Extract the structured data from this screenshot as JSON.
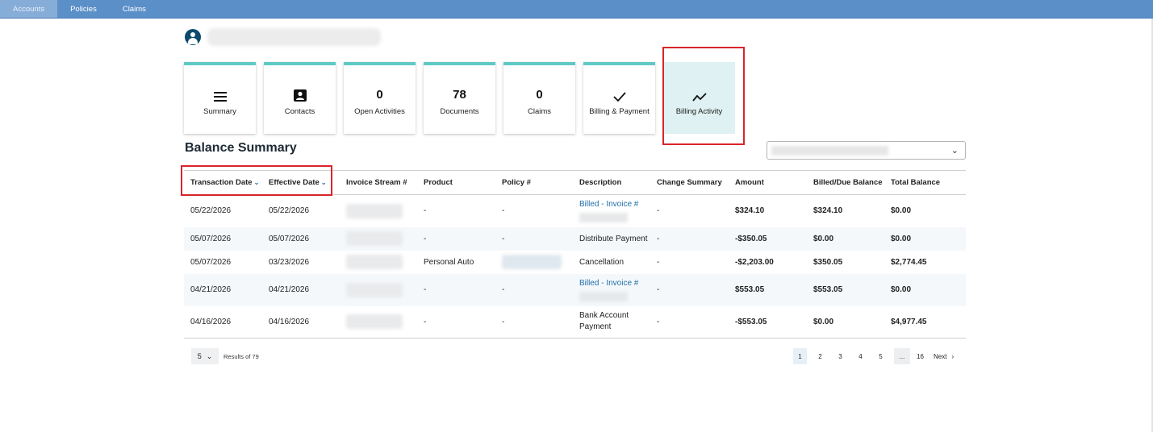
{
  "nav": {
    "tabs": [
      {
        "label": "Accounts"
      },
      {
        "label": "Policies"
      },
      {
        "label": "Claims"
      }
    ]
  },
  "tiles": [
    {
      "icon": "menu-icon",
      "value": "",
      "label": "Summary"
    },
    {
      "icon": "contact-card-icon",
      "value": "",
      "label": "Contacts"
    },
    {
      "icon": "",
      "value": "0",
      "label": "Open Activities"
    },
    {
      "icon": "",
      "value": "78",
      "label": "Documents"
    },
    {
      "icon": "",
      "value": "0",
      "label": "Claims"
    },
    {
      "icon": "checkmark-icon",
      "value": "",
      "label": "Billing & Payment"
    },
    {
      "icon": "trend-line-icon",
      "value": "",
      "label": "Billing Activity"
    }
  ],
  "section": {
    "title": "Balance Summary"
  },
  "table": {
    "headers": [
      "Transaction Date",
      "Effective Date",
      "Invoice Stream #",
      "Product",
      "Policy #",
      "Description",
      "Change Summary",
      "Amount",
      "Billed/Due Balance",
      "Total Balance"
    ],
    "rows": [
      {
        "transaction_date": "05/22/2026",
        "effective_date": "05/22/2026",
        "product": "-",
        "policy": "-",
        "description": "Billed - Invoice #",
        "change_summary": "-",
        "amount": "$324.10",
        "billed_due": "$324.10",
        "total": "$0.00"
      },
      {
        "transaction_date": "05/07/2026",
        "effective_date": "05/07/2026",
        "product": "-",
        "policy": "-",
        "description": "Distribute Payment",
        "change_summary": "-",
        "amount": "-$350.05",
        "billed_due": "$0.00",
        "total": "$0.00"
      },
      {
        "transaction_date": "05/07/2026",
        "effective_date": "03/23/2026",
        "product": "Personal Auto",
        "policy": "",
        "description": "Cancellation",
        "change_summary": "-",
        "amount": "-$2,203.00",
        "billed_due": "$350.05",
        "total": "$2,774.45"
      },
      {
        "transaction_date": "04/21/2026",
        "effective_date": "04/21/2026",
        "product": "-",
        "policy": "-",
        "description": "Billed - Invoice #",
        "change_summary": "-",
        "amount": "$553.05",
        "billed_due": "$553.05",
        "total": "$0.00"
      },
      {
        "transaction_date": "04/16/2026",
        "effective_date": "04/16/2026",
        "product": "-",
        "policy": "-",
        "description": "Bank Account Payment",
        "change_summary": "-",
        "amount": "-$553.05",
        "billed_due": "$0.00",
        "total": "$4,977.45"
      }
    ]
  },
  "pagination": {
    "page_size": "5",
    "results_text": "Results of 79",
    "pages": [
      "1",
      "2",
      "3",
      "4",
      "5",
      "...",
      "16"
    ],
    "next_label": "Next"
  }
}
